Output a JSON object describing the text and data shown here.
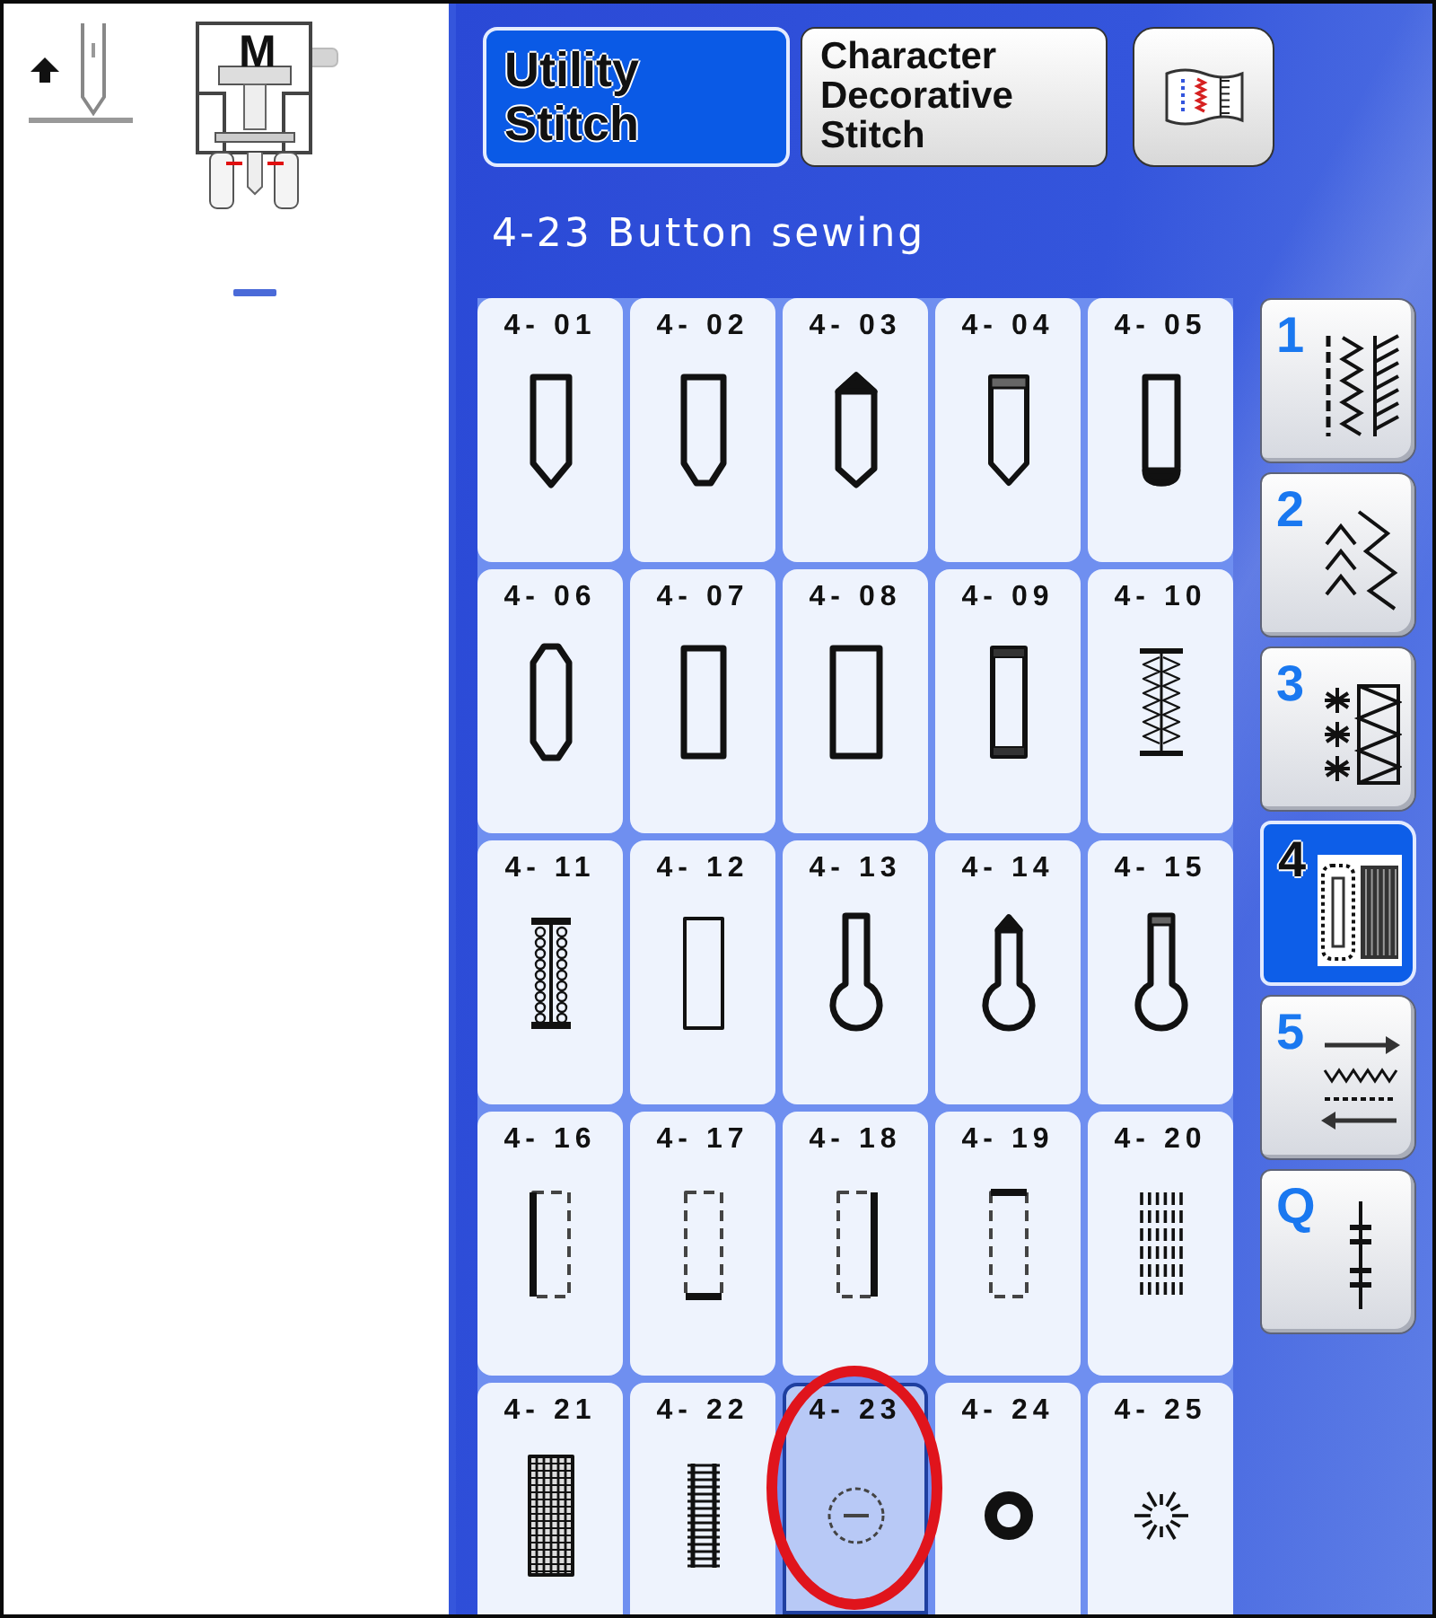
{
  "presser_foot": {
    "label": "M"
  },
  "tabs": [
    {
      "label": "Utility Stitch",
      "selected": true
    },
    {
      "label": "Character Decorative Stitch",
      "selected": false
    }
  ],
  "title": "4-23 Button sewing",
  "stitches": [
    {
      "number": "4- 01",
      "kind": "point",
      "selected": false,
      "circled": false
    },
    {
      "number": "4- 02",
      "kind": "widepoint",
      "selected": false,
      "circled": false
    },
    {
      "number": "4- 03",
      "kind": "doublepoint",
      "selected": false,
      "circled": false
    },
    {
      "number": "4- 04",
      "kind": "pointbar",
      "selected": false,
      "circled": false
    },
    {
      "number": "4- 05",
      "kind": "roundend",
      "selected": false,
      "circled": false
    },
    {
      "number": "4- 06",
      "kind": "hexagon",
      "selected": false,
      "circled": false
    },
    {
      "number": "4- 07",
      "kind": "rectangle",
      "selected": false,
      "circled": false
    },
    {
      "number": "4- 08",
      "kind": "widerect",
      "selected": false,
      "circled": false
    },
    {
      "number": "4- 09",
      "kind": "bartack",
      "selected": false,
      "circled": false
    },
    {
      "number": "4- 10",
      "kind": "zigzag",
      "selected": false,
      "circled": false
    },
    {
      "number": "4- 11",
      "kind": "heirloom",
      "selected": false,
      "circled": false
    },
    {
      "number": "4- 12",
      "kind": "thinrect",
      "selected": false,
      "circled": false
    },
    {
      "number": "4- 13",
      "kind": "keyhole",
      "selected": false,
      "circled": false
    },
    {
      "number": "4- 14",
      "kind": "keyholepoint",
      "selected": false,
      "circled": false
    },
    {
      "number": "4- 15",
      "kind": "keyholebar",
      "selected": false,
      "circled": false
    },
    {
      "number": "4- 16",
      "kind": "leftsolid",
      "selected": false,
      "circled": false
    },
    {
      "number": "4- 17",
      "kind": "bottomsolid",
      "selected": false,
      "circled": false
    },
    {
      "number": "4- 18",
      "kind": "rightsolid",
      "selected": false,
      "circled": false
    },
    {
      "number": "4- 19",
      "kind": "topsolid",
      "selected": false,
      "circled": false
    },
    {
      "number": "4- 20",
      "kind": "darning",
      "selected": false,
      "circled": false
    },
    {
      "number": "4- 21",
      "kind": "grid",
      "selected": false,
      "circled": false
    },
    {
      "number": "4- 22",
      "kind": "ladder",
      "selected": false,
      "circled": false
    },
    {
      "number": "4- 23",
      "kind": "button",
      "selected": true,
      "circled": true
    },
    {
      "number": "4- 24",
      "kind": "ring",
      "selected": false,
      "circled": false
    },
    {
      "number": "4- 25",
      "kind": "burst",
      "selected": false,
      "circled": false
    }
  ],
  "categories": [
    {
      "label": "1",
      "kind": "straight",
      "selected": false
    },
    {
      "label": "2",
      "kind": "chevron",
      "selected": false
    },
    {
      "label": "3",
      "kind": "decorative",
      "selected": false
    },
    {
      "label": "4",
      "kind": "buttonhole",
      "selected": true
    },
    {
      "label": "5",
      "kind": "sideways",
      "selected": false
    },
    {
      "label": "Q",
      "kind": "quilting",
      "selected": false
    }
  ]
}
